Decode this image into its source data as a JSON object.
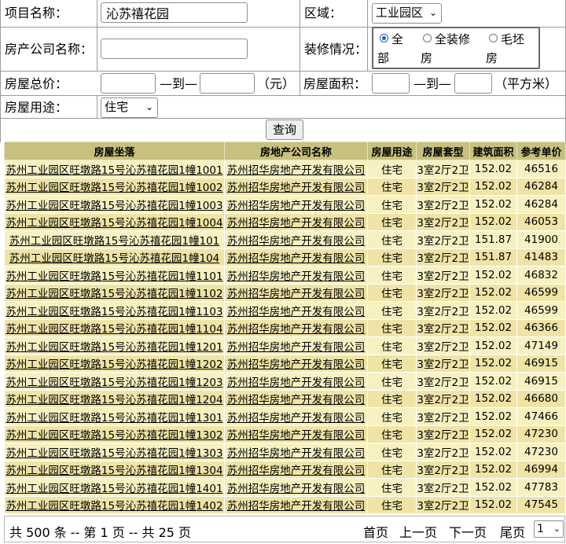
{
  "form": {
    "project_name_label": "项目名称：",
    "project_name_value": "沁苏禧花园",
    "region_label": "区域：",
    "region_value": "工业园区",
    "company_label": "房产公司名称：",
    "company_value": "",
    "decoration_label": "装修情况：",
    "decoration_options": [
      {
        "label_line1": "全",
        "label_line2": "部",
        "checked": true
      },
      {
        "label_line1": "全装修",
        "label_line2": "房",
        "checked": false
      },
      {
        "label_line1": "毛坯",
        "label_line2": "房",
        "checked": false
      }
    ],
    "total_price_label": "房屋总价：",
    "range_to": "—到—",
    "price_unit": "（元）",
    "area_label": "房屋面积：",
    "area_unit": "（平方米）",
    "usage_label": "房屋用途：",
    "usage_value": "住宅",
    "query_button": "查询"
  },
  "table": {
    "headers": [
      "房屋坐落",
      "房地产公司名称",
      "房屋用途",
      "房屋套型",
      "建筑面积",
      "参考单价"
    ],
    "rows": [
      [
        "苏州工业园区旺墩路15号沁苏禧花园1幢1001",
        "苏州招华房地产开发有限公司",
        "住宅",
        "3室2厅2卫",
        "152.02",
        "46516"
      ],
      [
        "苏州工业园区旺墩路15号沁苏禧花园1幢1002",
        "苏州招华房地产开发有限公司",
        "住宅",
        "3室2厅2卫",
        "152.02",
        "46284"
      ],
      [
        "苏州工业园区旺墩路15号沁苏禧花园1幢1003",
        "苏州招华房地产开发有限公司",
        "住宅",
        "3室2厅2卫",
        "152.02",
        "46284"
      ],
      [
        "苏州工业园区旺墩路15号沁苏禧花园1幢1004",
        "苏州招华房地产开发有限公司",
        "住宅",
        "3室2厅2卫",
        "152.02",
        "46053"
      ],
      [
        "苏州工业园区旺墩路15号沁苏禧花园1幢101",
        "苏州招华房地产开发有限公司",
        "住宅",
        "3室2厅2卫",
        "151.87",
        "41900"
      ],
      [
        "苏州工业园区旺墩路15号沁苏禧花园1幢104",
        "苏州招华房地产开发有限公司",
        "住宅",
        "3室2厅2卫",
        "151.87",
        "41483"
      ],
      [
        "苏州工业园区旺墩路15号沁苏禧花园1幢1101",
        "苏州招华房地产开发有限公司",
        "住宅",
        "3室2厅2卫",
        "152.02",
        "46832"
      ],
      [
        "苏州工业园区旺墩路15号沁苏禧花园1幢1102",
        "苏州招华房地产开发有限公司",
        "住宅",
        "3室2厅2卫",
        "152.02",
        "46599"
      ],
      [
        "苏州工业园区旺墩路15号沁苏禧花园1幢1103",
        "苏州招华房地产开发有限公司",
        "住宅",
        "3室2厅2卫",
        "152.02",
        "46599"
      ],
      [
        "苏州工业园区旺墩路15号沁苏禧花园1幢1104",
        "苏州招华房地产开发有限公司",
        "住宅",
        "3室2厅2卫",
        "152.02",
        "46366"
      ],
      [
        "苏州工业园区旺墩路15号沁苏禧花园1幢1201",
        "苏州招华房地产开发有限公司",
        "住宅",
        "3室2厅2卫",
        "152.02",
        "47149"
      ],
      [
        "苏州工业园区旺墩路15号沁苏禧花园1幢1202",
        "苏州招华房地产开发有限公司",
        "住宅",
        "3室2厅2卫",
        "152.02",
        "46915"
      ],
      [
        "苏州工业园区旺墩路15号沁苏禧花园1幢1203",
        "苏州招华房地产开发有限公司",
        "住宅",
        "3室2厅2卫",
        "152.02",
        "46915"
      ],
      [
        "苏州工业园区旺墩路15号沁苏禧花园1幢1204",
        "苏州招华房地产开发有限公司",
        "住宅",
        "3室2厅2卫",
        "152.02",
        "46680"
      ],
      [
        "苏州工业园区旺墩路15号沁苏禧花园1幢1301",
        "苏州招华房地产开发有限公司",
        "住宅",
        "3室2厅2卫",
        "152.02",
        "47466"
      ],
      [
        "苏州工业园区旺墩路15号沁苏禧花园1幢1302",
        "苏州招华房地产开发有限公司",
        "住宅",
        "3室2厅2卫",
        "152.02",
        "47230"
      ],
      [
        "苏州工业园区旺墩路15号沁苏禧花园1幢1303",
        "苏州招华房地产开发有限公司",
        "住宅",
        "3室2厅2卫",
        "152.02",
        "47230"
      ],
      [
        "苏州工业园区旺墩路15号沁苏禧花园1幢1304",
        "苏州招华房地产开发有限公司",
        "住宅",
        "3室2厅2卫",
        "152.02",
        "46994"
      ],
      [
        "苏州工业园区旺墩路15号沁苏禧花园1幢1401",
        "苏州招华房地产开发有限公司",
        "住宅",
        "3室2厅2卫",
        "152.02",
        "47783"
      ],
      [
        "苏州工业园区旺墩路15号沁苏禧花园1幢1402",
        "苏州招华房地产开发有限公司",
        "住宅",
        "3室2厅2卫",
        "152.02",
        "47545"
      ]
    ]
  },
  "pagination": {
    "summary": "共 500 条 -- 第 1 页 -- 共 25 页",
    "first": "首页",
    "prev": "上一页",
    "next": "下一页",
    "last": "尾页",
    "page_value": "1"
  }
}
